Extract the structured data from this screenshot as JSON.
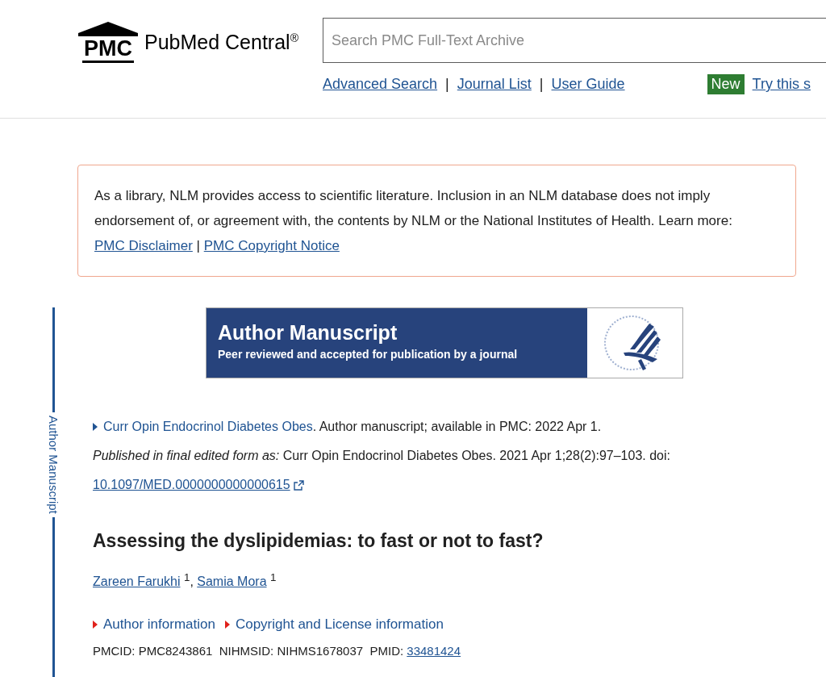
{
  "header": {
    "logo": {
      "acronym": "PMC",
      "name": "PubMed Central",
      "mark": "®"
    },
    "search": {
      "placeholder": "Search PMC Full-Text Archive"
    },
    "links": [
      "Advanced Search",
      "Journal List",
      "User Guide"
    ],
    "link_separator": "|",
    "badge": "New",
    "promo_link": "Try this s"
  },
  "notice": {
    "text": "As a library, NLM provides access to scientific literature. Inclusion in an NLM database does not imply endorsement of, or agreement with, the contents by NLM or the National Institutes of Health. Learn more:",
    "links": [
      "PMC Disclaimer",
      "PMC Copyright Notice"
    ],
    "link_separator": "|"
  },
  "banner": {
    "title": "Author Manuscript",
    "subtitle": "Peer reviewed and accepted for publication by a journal"
  },
  "side_label": "Author Manuscript",
  "citation": {
    "journal": "Curr Opin Endocrinol Diabetes Obes",
    "text": ". Author manuscript; available in PMC: 2022 Apr 1.",
    "published_lead": "Published in final edited form as:",
    "published_text": "Curr Opin Endocrinol Diabetes Obes. 2021 Apr 1;28(2):97–103. doi:",
    "doi": "10.1097/MED.0000000000000615"
  },
  "title": "Assessing the dyslipidemias: to fast or not to fast?",
  "author_separator": ",",
  "authors": [
    {
      "name": "Zareen Farukhi",
      "affiliation": "1"
    },
    {
      "name": "Samia Mora",
      "affiliation": "1"
    }
  ],
  "sections": [
    {
      "label": "Author information",
      "expanded": false
    },
    {
      "label": "Copyright and License information",
      "expanded": false
    }
  ],
  "ids": {
    "text": "PMCID: PMC8243861  NIHMSID: NIHMS1678037  PMID:",
    "pmid": "33481424"
  }
}
